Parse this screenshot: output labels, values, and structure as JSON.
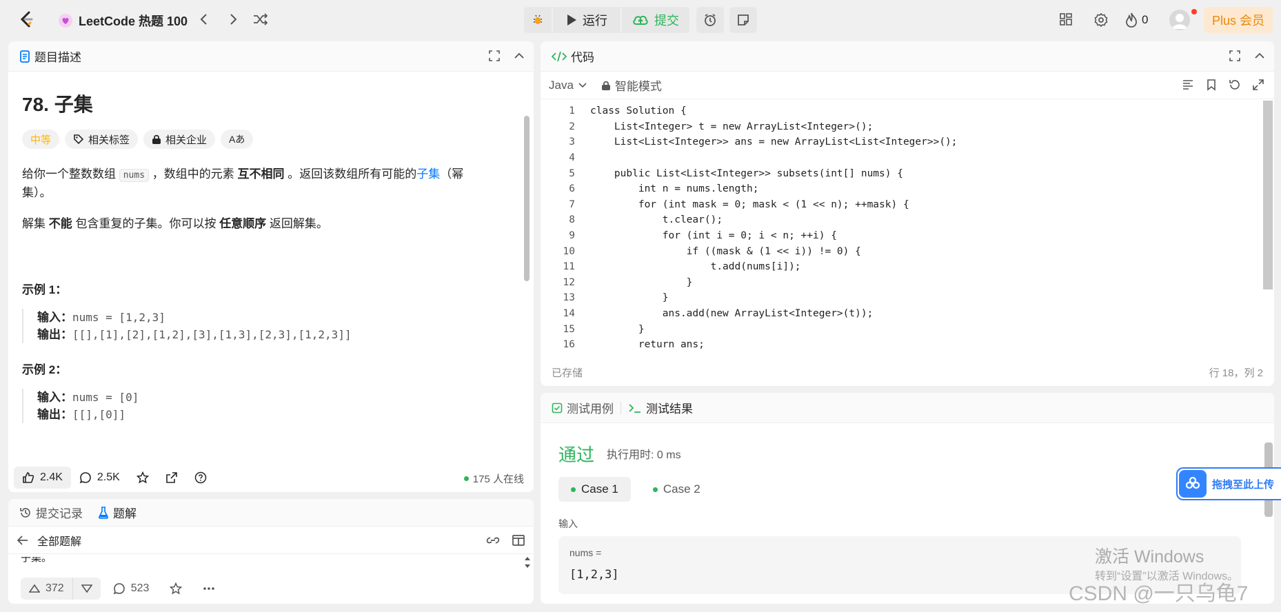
{
  "topbar": {
    "list_title": "LeetCode 热题 100",
    "run_label": "运行",
    "submit_label": "提交",
    "streak_count": "0",
    "plus_label": "Plus 会员"
  },
  "description": {
    "panel_title": "题目描述",
    "problem_title": "78. 子集",
    "difficulty": "中等",
    "tag_topics": "相关标签",
    "tag_companies": "相关企业",
    "tag_translate": "Aあ",
    "para1_a": "给你一个整数数组 ",
    "para1_code": "nums",
    "para1_b": " ，数组中的元素 ",
    "para1_bold": "互不相同",
    "para1_c": " 。返回该数组所有可能的",
    "para1_link": "子集",
    "para1_d": "（幂集）。",
    "para2_a": "解集 ",
    "para2_bold1": "不能",
    "para2_b": " 包含重复的子集。你可以按 ",
    "para2_bold2": "任意顺序",
    "para2_c": " 返回解集。",
    "examples": [
      {
        "heading": "示例 1：",
        "input_label": "输入：",
        "input": "nums = [1,2,3]",
        "output_label": "输出：",
        "output": "[[],[1],[2],[1,2],[3],[1,3],[2,3],[1,2,3]]"
      },
      {
        "heading": "示例 2：",
        "input_label": "输入：",
        "input": "nums = [0]",
        "output_label": "输出：",
        "output": "[[],[0]]"
      }
    ],
    "likes": "2.4K",
    "comments": "2.5K",
    "online": "175 人在线"
  },
  "solutions": {
    "tab_submissions": "提交记录",
    "tab_solutions": "题解",
    "all_solutions": "全部题解",
    "partial_text": "子集。",
    "upvotes": "372",
    "comment_count": "523"
  },
  "code": {
    "panel_title": "代码",
    "language": "Java",
    "smart_mode": "智能模式",
    "lines": [
      {
        "n": "1",
        "t": "class Solution {"
      },
      {
        "n": "2",
        "t": "    List<Integer> t = new ArrayList<Integer>();"
      },
      {
        "n": "3",
        "t": "    List<List<Integer>> ans = new ArrayList<List<Integer>>();"
      },
      {
        "n": "4",
        "t": ""
      },
      {
        "n": "5",
        "t": "    public List<List<Integer>> subsets(int[] nums) {"
      },
      {
        "n": "6",
        "t": "        int n = nums.length;"
      },
      {
        "n": "7",
        "t": "        for (int mask = 0; mask < (1 << n); ++mask) {"
      },
      {
        "n": "8",
        "t": "            t.clear();"
      },
      {
        "n": "9",
        "t": "            for (int i = 0; i < n; ++i) {"
      },
      {
        "n": "10",
        "t": "                if ((mask & (1 << i)) != 0) {"
      },
      {
        "n": "11",
        "t": "                    t.add(nums[i]);"
      },
      {
        "n": "12",
        "t": "                }"
      },
      {
        "n": "13",
        "t": "            }"
      },
      {
        "n": "14",
        "t": "            ans.add(new ArrayList<Integer>(t));"
      },
      {
        "n": "15",
        "t": "        }"
      },
      {
        "n": "16",
        "t": "        return ans;"
      }
    ],
    "status": "已存储",
    "cursor_position": "行 18，列 2"
  },
  "test": {
    "tab_cases": "测试用例",
    "tab_results": "测试结果",
    "verdict": "通过",
    "runtime": "执行用时: 0 ms",
    "case1": "Case 1",
    "case2": "Case 2",
    "input_label": "输入",
    "input_name": "nums =",
    "input_value": "[1,2,3]"
  },
  "overlay": {
    "upload_label": "拖拽至此上传",
    "windows_title": "激活 Windows",
    "windows_sub": "转到“设置”以激活 Windows。",
    "watermark": "CSDN @一只乌龟7"
  },
  "colors": {
    "accent_green": "#2db55d",
    "difficulty_medium": "#ffb800",
    "link_blue": "#007aff",
    "plus_orange": "#e8890c"
  }
}
